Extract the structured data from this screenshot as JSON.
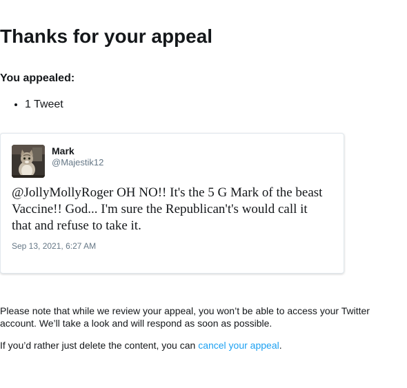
{
  "page": {
    "title": "Thanks for your appeal"
  },
  "appealed": {
    "label": "You appealed:",
    "items": [
      "1 Tweet"
    ]
  },
  "tweet": {
    "avatar": "cat-avatar-photo",
    "name": "Mark",
    "handle": "@Majestik12",
    "text": "@JollyMollyRoger OH NO!! It's the 5 G Mark of the beast Vaccine!! God... I'm sure the Republican't's would call it that and refuse to take it.",
    "timestamp": "Sep 13, 2021, 6:27 AM"
  },
  "notice": {
    "text": "Please note that while we review your appeal, you won’t be able to access your Twitter account. We’ll take a look and will respond as soon as possible.",
    "cancel_prefix": "If you’d rather just delete the content, you can ",
    "cancel_link": "cancel your appeal",
    "cancel_suffix": "."
  },
  "colors": {
    "text": "#14171a",
    "secondary": "#657786",
    "link": "#1da1f2",
    "border": "#e1e8ed"
  }
}
